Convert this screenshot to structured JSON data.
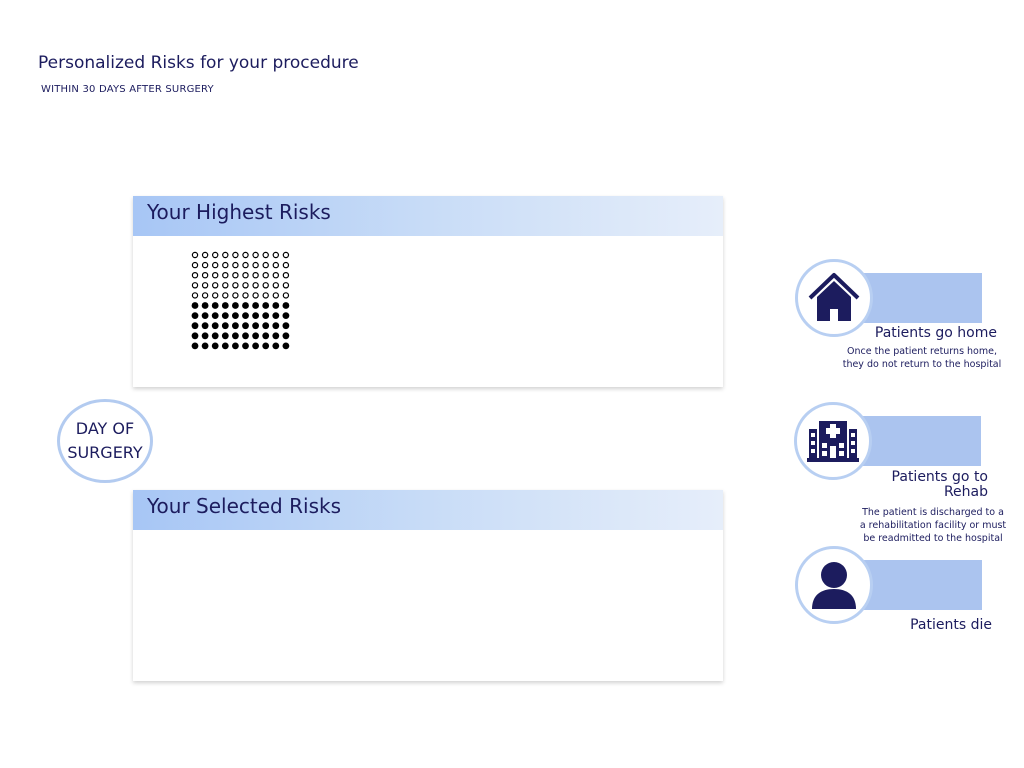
{
  "header": {
    "title": "Personalized Risks for your procedure",
    "subtitle": "WITHIN 30 DAYS AFTER SURGERY"
  },
  "panels": {
    "highest": {
      "title": "Your Highest Risks",
      "dot_grid": {
        "total": 100,
        "filled": 50
      }
    },
    "selected": {
      "title": "Your Selected Risks"
    }
  },
  "day_of_surgery": {
    "line1": "DAY OF",
    "line2": "SURGERY"
  },
  "outcomes": [
    {
      "icon": "house-icon",
      "label": "Patients go home",
      "desc_line1": "Once the patient returns home,",
      "desc_line2": "they do not return to the hospital"
    },
    {
      "icon": "hospital-icon",
      "label_line1": "Patients go to",
      "label_line2": "Rehab",
      "desc_line1": "The patient is discharged to a",
      "desc_line2": "a rehabilitation facility or must",
      "desc_line3": "be readmitted to the hospital"
    },
    {
      "icon": "person-icon",
      "label": "Patients die"
    }
  ],
  "colors": {
    "text": "#1c1c5e",
    "accent_bar": "#abc4ef",
    "circle_border": "#b8cff2"
  }
}
